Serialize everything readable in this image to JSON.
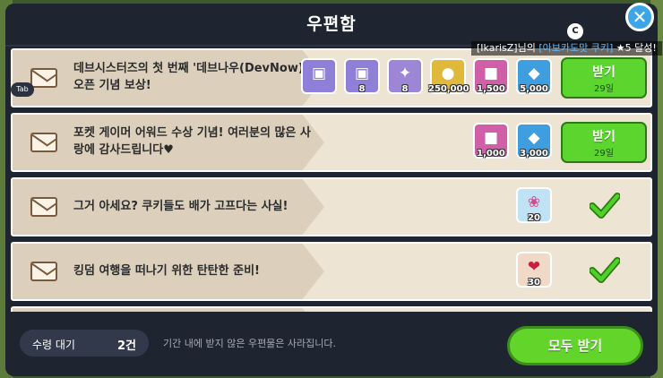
{
  "window": {
    "title": "우편함",
    "c_badge": "C",
    "close_glyph": "✕"
  },
  "notice": {
    "user": "[IkarisZ]",
    "mid": "님의 ",
    "cookie": "[아보카도맛 쿠키]",
    "tail": " ★5 달성!"
  },
  "tab_label": "Tab",
  "colors": {
    "claim_green": "#5cd62e",
    "check_green": "#3cb81f",
    "panel": "#1e2430"
  },
  "mails": [
    {
      "title": "데브시스터즈의 첫 번째 '데브나우(DevNow)' 오픈 기념 보상!",
      "status": "claim",
      "button": "받기",
      "days": "29일",
      "rewards": [
        {
          "icon": "treasure-chest-icon",
          "amount": "8"
        },
        {
          "icon": "bone-treasure-icon",
          "amount": "8"
        },
        {
          "icon": "coin-icon",
          "amount": "250,000"
        },
        {
          "icon": "magic-cube-icon",
          "amount": "1,500"
        },
        {
          "icon": "crystal-icon",
          "amount": "5,000"
        }
      ]
    },
    {
      "title": "포켓 게이머 어워드 수상 기념! 여러분의 많은 사랑에 감사드립니다♥",
      "status": "claim",
      "button": "받기",
      "days": "29일",
      "rewards": [
        {
          "icon": "magic-cube-icon",
          "amount": "1,000"
        },
        {
          "icon": "crystal-icon",
          "amount": "3,000"
        }
      ]
    },
    {
      "title": "그거 아세요? 쿠키들도 배가 고프다는 사실!",
      "status": "claimed",
      "rewards": [
        {
          "icon": "candy-jar-icon",
          "amount": "20"
        }
      ]
    },
    {
      "title": "킹덤 여행을 떠나기 위한 탄탄한 준비!",
      "status": "claimed",
      "rewards": [
        {
          "icon": "heart-potion-icon",
          "amount": "30"
        }
      ]
    }
  ],
  "footer": {
    "pending_label": "수령 대기",
    "pending_value": "2건",
    "note": "기간 내에 받지 않은 우편물은 사라집니다.",
    "claim_all": "모두 받기"
  }
}
